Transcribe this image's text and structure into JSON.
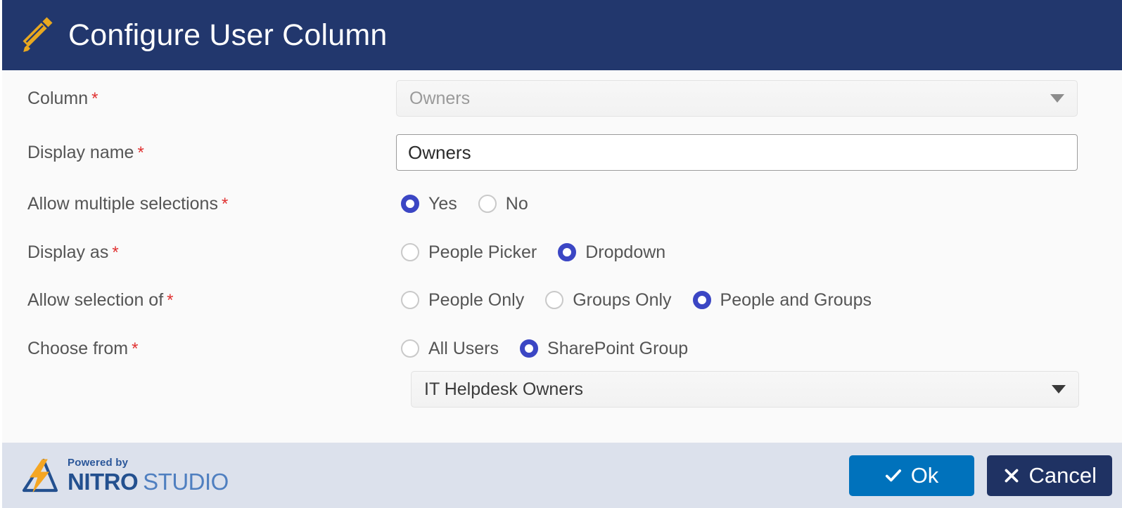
{
  "header": {
    "title": "Configure User Column",
    "icon": "pencil-icon",
    "background_color": "#22376D"
  },
  "form": {
    "required_marker": "*",
    "rows": [
      {
        "label": "Column",
        "required": true,
        "control": "select",
        "value": "Owners",
        "disabled": true
      },
      {
        "label": "Display name",
        "required": true,
        "control": "text",
        "value": "Owners"
      },
      {
        "label": "Allow multiple selections",
        "required": true,
        "control": "radio",
        "options": [
          "Yes",
          "No"
        ],
        "selected": "Yes"
      },
      {
        "label": "Display as",
        "required": true,
        "control": "radio",
        "options": [
          "People Picker",
          "Dropdown"
        ],
        "selected": "Dropdown"
      },
      {
        "label": "Allow selection of",
        "required": true,
        "control": "radio",
        "options": [
          "People Only",
          "Groups Only",
          "People and Groups"
        ],
        "selected": "People and Groups"
      },
      {
        "label": "Choose from",
        "required": true,
        "control": "radio-with-select",
        "options": [
          "All Users",
          "SharePoint Group"
        ],
        "selected": "SharePoint Group",
        "select_value": "IT Helpdesk Owners"
      }
    ]
  },
  "footer": {
    "brand": {
      "powered_by": "Powered by",
      "name_bold": "NITRO",
      "name_light": "STUDIO",
      "logo": "nitro-lightning-logo"
    },
    "buttons": {
      "ok": {
        "label": "Ok",
        "icon": "check-icon",
        "color": "#0072BC"
      },
      "cancel": {
        "label": "Cancel",
        "icon": "close-icon",
        "color": "#1F3263"
      }
    },
    "background_color": "#DCE1EC"
  },
  "colors": {
    "accent_radio": "#3B46C4",
    "required_asterisk": "#E03131",
    "label_text": "#555555",
    "body_background": "#FAFAFA"
  }
}
